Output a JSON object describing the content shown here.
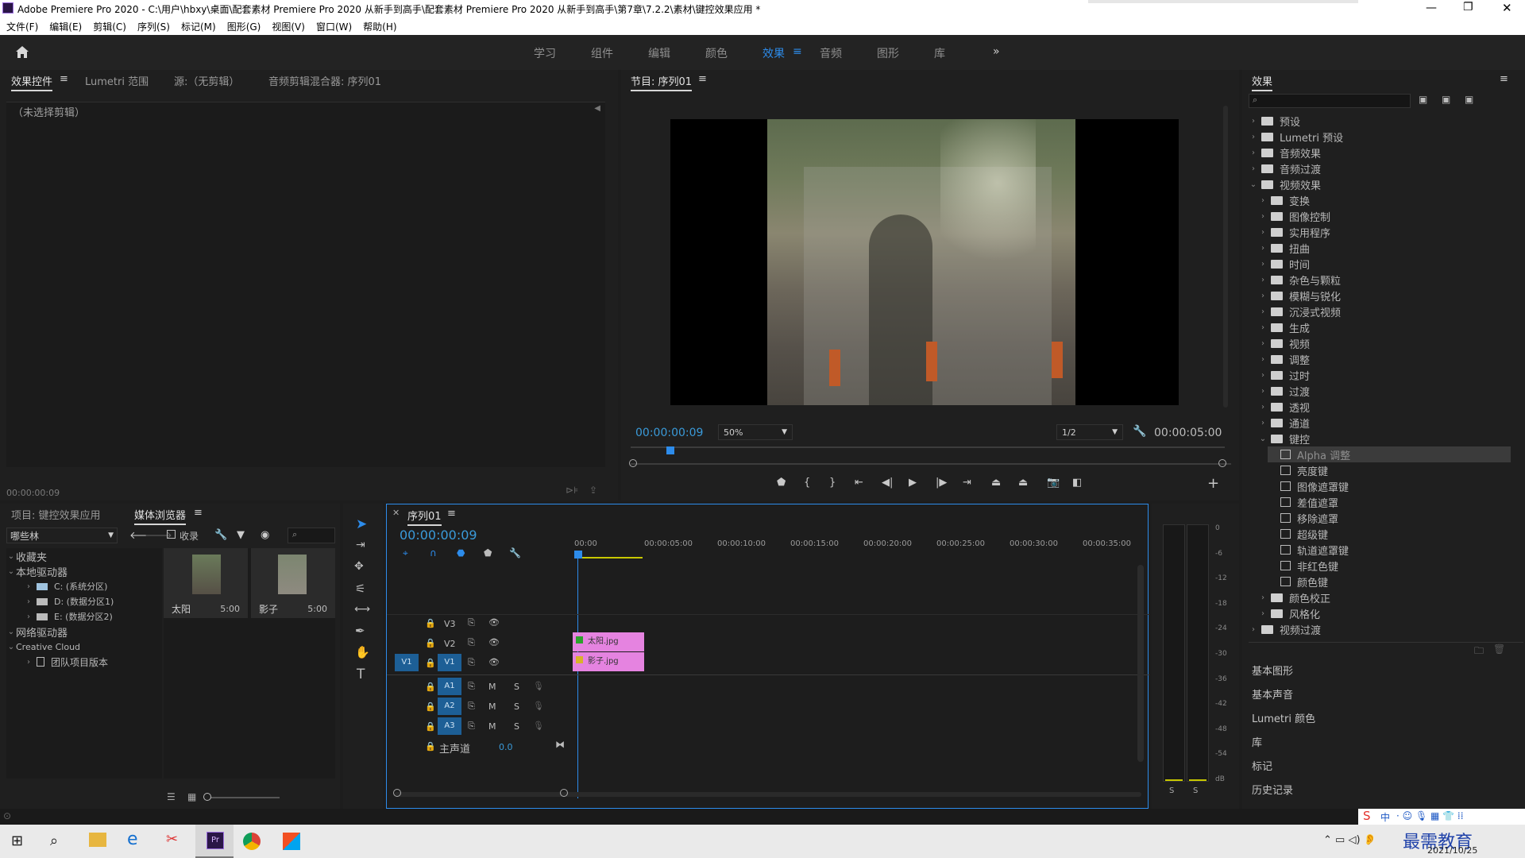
{
  "titlebar": {
    "title": "Adobe Premiere Pro 2020 - C:\\用户\\hbxy\\桌面\\配套素材 Premiere Pro 2020 从新手到高手\\配套素材 Premiere Pro 2020 从新手到高手\\第7章\\7.2.2\\素材\\键控效果应用 *"
  },
  "menu": [
    "文件(F)",
    "编辑(E)",
    "剪辑(C)",
    "序列(S)",
    "标记(M)",
    "图形(G)",
    "视图(V)",
    "窗口(W)",
    "帮助(H)"
  ],
  "workspaces": [
    "学习",
    "组件",
    "编辑",
    "颜色",
    "效果",
    "音频",
    "图形",
    "库"
  ],
  "active_workspace": "效果",
  "effect_controls": {
    "tabs": [
      "效果控件",
      "Lumetri 范围",
      "源:（无剪辑）",
      "音频剪辑混合器: 序列01"
    ],
    "no_clip": "（未选择剪辑）",
    "timecode": "00:00:00:09"
  },
  "program": {
    "title": "节目: 序列01",
    "timecode": "00:00:00:09",
    "zoom": "50%",
    "resolution": "1/2",
    "duration": "00:00:05:00",
    "playhead_fraction": 0.06
  },
  "project": {
    "tabs": [
      "项目: 键控效果应用",
      "媒体浏览器"
    ],
    "dropdown": "哪些林",
    "favorites_label": "收录",
    "tree": [
      "收藏夹",
      "本地驱动器",
      "C: (系统分区)",
      "D: (数据分区1)",
      "E: (数据分区2)",
      "网络驱动器",
      "Creative Cloud",
      "团队项目版本"
    ],
    "thumbs": [
      {
        "name": "太阳",
        "dur": "5:00"
      },
      {
        "name": "影子",
        "dur": "5:00"
      }
    ]
  },
  "sequence": {
    "title": "序列01",
    "timecode": "00:00:00:09",
    "ruler": [
      "00:00",
      "00:00:05:00",
      "00:00:10:00",
      "00:00:15:00",
      "00:00:20:00",
      "00:00:25:00",
      "00:00:30:00",
      "00:00:35:00"
    ],
    "tracks": [
      "V3",
      "V2",
      "V1",
      "A1",
      "A2",
      "A3"
    ],
    "master": "主声道",
    "master_val": "0.0",
    "clips": [
      {
        "name": "太阳.jpg",
        "track": "V2"
      },
      {
        "name": "影子.jpg",
        "track": "V1"
      }
    ],
    "toggle_m": "M",
    "toggle_s": "S",
    "src_v1": "V1"
  },
  "meter": {
    "ticks": [
      "0",
      "-6",
      "-12",
      "-18",
      "-24",
      "-30",
      "-36",
      "-42",
      "-48",
      "-54",
      "dB"
    ],
    "solo": "S"
  },
  "effects": {
    "title": "效果",
    "tree": [
      {
        "label": "预设",
        "level": 0,
        "open": false
      },
      {
        "label": "Lumetri 预设",
        "level": 0,
        "open": false
      },
      {
        "label": "音频效果",
        "level": 0,
        "open": false
      },
      {
        "label": "音频过渡",
        "level": 0,
        "open": false
      },
      {
        "label": "视频效果",
        "level": 0,
        "open": true
      },
      {
        "label": "变换",
        "level": 1,
        "open": false
      },
      {
        "label": "图像控制",
        "level": 1,
        "open": false
      },
      {
        "label": "实用程序",
        "level": 1,
        "open": false
      },
      {
        "label": "扭曲",
        "level": 1,
        "open": false
      },
      {
        "label": "时间",
        "level": 1,
        "open": false
      },
      {
        "label": "杂色与颗粒",
        "level": 1,
        "open": false
      },
      {
        "label": "模糊与锐化",
        "level": 1,
        "open": false
      },
      {
        "label": "沉浸式视频",
        "level": 1,
        "open": false
      },
      {
        "label": "生成",
        "level": 1,
        "open": false
      },
      {
        "label": "视频",
        "level": 1,
        "open": false
      },
      {
        "label": "调整",
        "level": 1,
        "open": false
      },
      {
        "label": "过时",
        "level": 1,
        "open": false
      },
      {
        "label": "过渡",
        "level": 1,
        "open": false
      },
      {
        "label": "透视",
        "level": 1,
        "open": false
      },
      {
        "label": "通道",
        "level": 1,
        "open": false
      },
      {
        "label": "键控",
        "level": 1,
        "open": true
      },
      {
        "label": "Alpha 调整",
        "level": 2,
        "selected": true
      },
      {
        "label": "亮度键",
        "level": 2
      },
      {
        "label": "图像遮罩键",
        "level": 2
      },
      {
        "label": "差值遮罩",
        "level": 2
      },
      {
        "label": "移除遮罩",
        "level": 2
      },
      {
        "label": "超级键",
        "level": 2
      },
      {
        "label": "轨道遮罩键",
        "level": 2
      },
      {
        "label": "非红色键",
        "level": 2
      },
      {
        "label": "颜色键",
        "level": 2
      },
      {
        "label": "颜色校正",
        "level": 1,
        "open": false
      },
      {
        "label": "风格化",
        "level": 1,
        "open": false
      },
      {
        "label": "视频过渡",
        "level": 0,
        "open": false
      }
    ],
    "sections": [
      "基本图形",
      "基本声音",
      "Lumetri 颜色",
      "库",
      "标记",
      "历史记录"
    ]
  },
  "taskbar": {
    "date": "2021/10/25",
    "watermark": "最需教育",
    "ime": "中"
  },
  "colors": {
    "accent": "#2d8ceb",
    "clip": "#e583e0",
    "timecode": "#2d8ceb"
  }
}
